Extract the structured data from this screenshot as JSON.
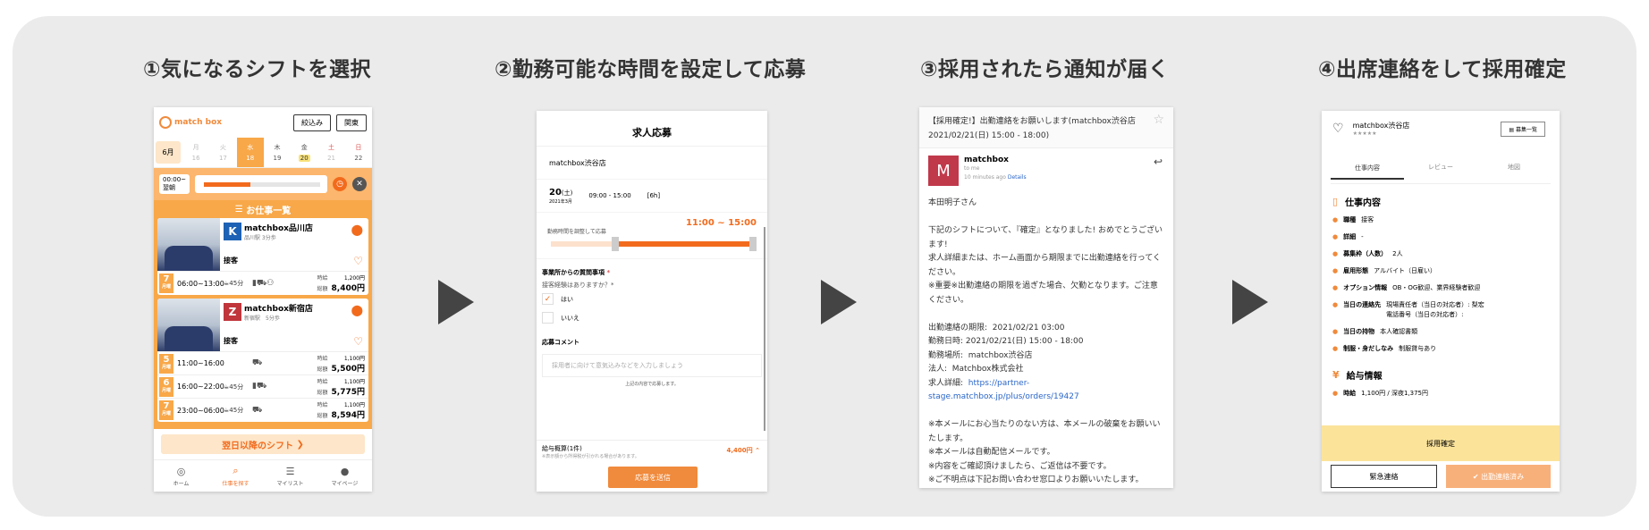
{
  "steps": [
    {
      "title": "①気になるシフトを選択"
    },
    {
      "title": "②勤務可能な時間を設定して応募"
    },
    {
      "title": "③採用されたら通知が届く"
    },
    {
      "title": "④出席連絡をして採用確定"
    }
  ],
  "screen1": {
    "logo": "match box",
    "filter_btn": "絞込み",
    "about_btn": "関東",
    "month": "6月",
    "days": [
      {
        "wd": "月",
        "d": "16"
      },
      {
        "wd": "火",
        "d": "17"
      },
      {
        "wd": "水",
        "d": "18"
      },
      {
        "wd": "木",
        "d": "19"
      },
      {
        "wd": "金",
        "d": "20"
      },
      {
        "wd": "土",
        "d": "21"
      },
      {
        "wd": "日",
        "d": "22"
      }
    ],
    "time_from": "00:00~",
    "time_to": "翌朝",
    "list_title": "お仕事一覧",
    "jobs": [
      {
        "name": "matchbox品川店",
        "station": "品川駅 3分歩",
        "category": "接客",
        "logo": "K",
        "shifts": [
          {
            "day": "7",
            "dow": "月曜",
            "time": "06:00~13:00",
            "break": "45分",
            "hourly_label": "時給",
            "hourly": "1,200円",
            "total_label": "総額",
            "total": "8,400円"
          }
        ]
      },
      {
        "name": "matchbox新宿店",
        "station": "新宿駅　5分歩",
        "category": "接客",
        "logo": "Z",
        "shifts": [
          {
            "day": "5",
            "dow": "月曜",
            "time": "11:00~16:00",
            "break": "",
            "hourly_label": "時給",
            "hourly": "1,100円",
            "total_label": "総額",
            "total": "5,500円"
          },
          {
            "day": "6",
            "dow": "月曜",
            "time": "16:00~22:00",
            "break": "45分",
            "hourly_label": "時給",
            "hourly": "1,100円",
            "total_label": "総額",
            "total": "5,775円"
          },
          {
            "day": "7",
            "dow": "月曜",
            "time": "23:00~06:00",
            "break": "45分",
            "hourly_label": "時給",
            "hourly": "1,100円",
            "total_label": "総額",
            "total": "8,594円"
          }
        ]
      }
    ],
    "tomorrow_btn": "翌日以降のシフト",
    "tabs": [
      "ホーム",
      "仕事を探す",
      "マイリスト",
      "マイページ"
    ]
  },
  "screen2": {
    "title": "求人応募",
    "shop": "matchbox渋谷店",
    "date_day": "20",
    "date_dow": "(土)",
    "date_year": "2021年3月",
    "date_time": "09:00 - 15:00",
    "date_hours": "[6h]",
    "adjust_label": "勤務時間を調整して応募",
    "range": "11:00 ~ 15:00",
    "question_title": "事業所からの質問事項",
    "question_required": "*",
    "question": "接客経験はありますか？*",
    "opt_yes": "はい",
    "opt_no": "いいえ",
    "comment_title": "応募コメント",
    "comment_placeholder": "採用者に向けて意気込みなどを入力しましょう",
    "note": "上記の内容で応募します。",
    "pay_label": "給与概算(1件)",
    "pay_sub": "※表示額から所得税が引かれる場合があります。",
    "pay_amount": "4,400円",
    "submit": "応募を送信"
  },
  "screen3": {
    "subject": "【採用確定!】出勤連絡をお願いします(matchbox渋谷店 2021/02/21(日) 15:00 - 18:00)",
    "sender": "matchbox",
    "avatar": "M",
    "to": "to me",
    "time": "10 minutes ago",
    "details": "Details",
    "p1": "本田明子さん",
    "p2": "下記のシフトについて、『確定』となりました! おめでとうございます!\n求人詳細または、ホーム画面から期限までに出勤連絡を行ってください。\n※重要※出勤連絡の期限を過ぎた場合、欠勤となります。ご注意ください。",
    "p3a": "出勤連絡の期限:  2021/02/21 03:00\n勤務日時: 2021/02/21(日) 15:00 - 18:00\n勤務場所:  matchbox渋谷店\n法人:  Matchbox株式会社\n求人詳細:  ",
    "url": "https://partner-stage.matchbox.jp/plus/orders/19427",
    "p4": "※本メールにお心当たりのない方は、本メールの破棄をお願いいたします。\n※本メールは自動配信メールです。\n※内容をご確認頂けましたら、ご返信は不要です。\n※ご不明点は下記お問い合わせ窓口よりお願いいたします。"
  },
  "screen4": {
    "shop": "matchbox渋谷店",
    "stars": "★★★★★",
    "list_btn": "募集一覧",
    "tabs": [
      "仕事内容",
      "レビュー",
      "地図"
    ],
    "sec1": "仕事内容",
    "rows": [
      {
        "k": "職種",
        "v": "接客"
      },
      {
        "k": "詳細",
        "v": "-"
      },
      {
        "k": "募集枠（人数）",
        "v": "2人"
      },
      {
        "k": "雇用形態",
        "v": "アルバイト（日雇い）"
      },
      {
        "k": "オプション情報",
        "v": "OB・OG歓迎、業界経験者歓迎"
      },
      {
        "k": "当日の連絡先",
        "v": "現場責任者（当日の対応者）: 梨宏\n電話番号（当日の対応者）:"
      },
      {
        "k": "当日の持物",
        "v": "本人確認書類"
      },
      {
        "k": "制服・身だしなみ",
        "v": "制服貸与あり"
      }
    ],
    "sec2": "給与情報",
    "wage_k": "時給",
    "wage_v": "1,100円 / 深夜1,375円",
    "confirm": "採用確定",
    "urgent": "緊急連絡",
    "attended": "出勤連絡済み"
  },
  "colors": {
    "accent": "#f26b1d",
    "accent_light": "#f8a849",
    "confirm_bg": "#fbe39a"
  }
}
